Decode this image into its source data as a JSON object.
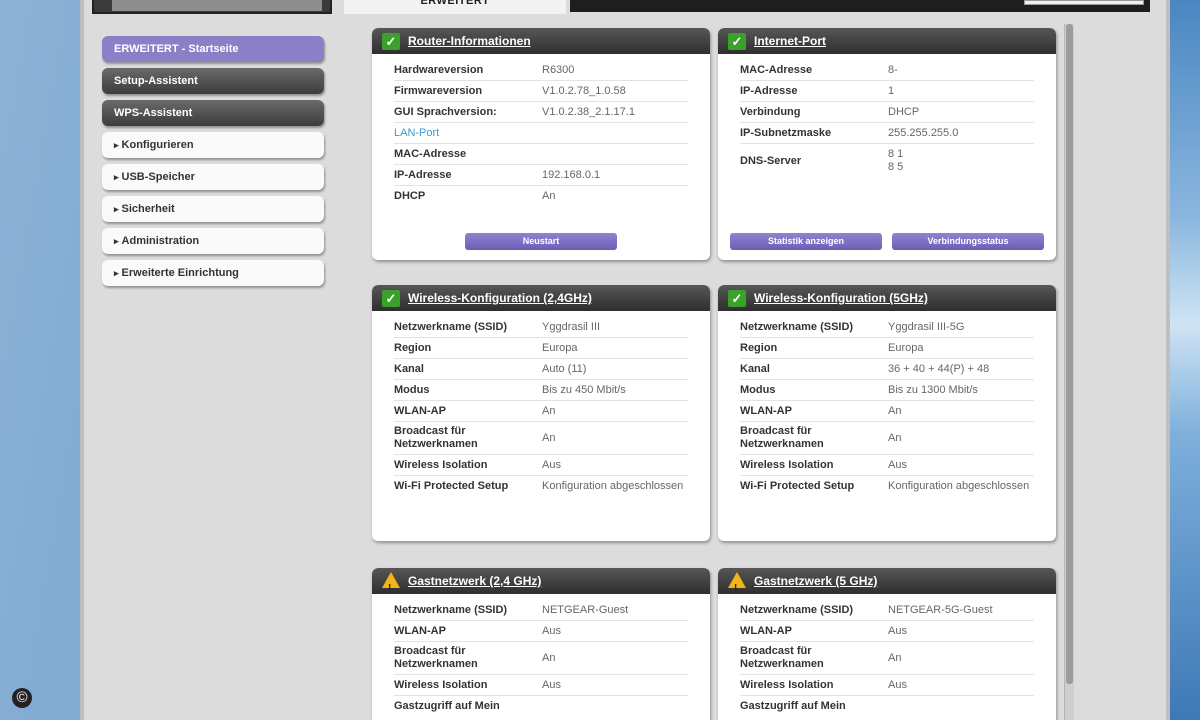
{
  "topbar": {
    "tab_erweitert": "ERWEITERT"
  },
  "sidebar": {
    "items": [
      {
        "label": "ERWEITERT - Startseite"
      },
      {
        "label": "Setup-Assistent"
      },
      {
        "label": "WPS-Assistent"
      },
      {
        "label": "Konfigurieren"
      },
      {
        "label": "USB-Speicher"
      },
      {
        "label": "Sicherheit"
      },
      {
        "label": "Administration"
      },
      {
        "label": "Erweiterte Einrichtung"
      }
    ]
  },
  "router": {
    "title": "Router-Informationen",
    "rows": [
      {
        "k": "Hardwareversion",
        "v": "R6300"
      },
      {
        "k": "Firmwareversion",
        "v": "V1.0.2.78_1.0.58"
      },
      {
        "k": "GUI Sprachversion:",
        "v": "V1.0.2.38_2.1.17.1"
      },
      {
        "k": "LAN-Port",
        "v": ""
      },
      {
        "k": "MAC-Adresse",
        "v": ""
      },
      {
        "k": "IP-Adresse",
        "v": "192.168.0.1"
      },
      {
        "k": "DHCP",
        "v": "An"
      }
    ],
    "button": "Neustart"
  },
  "internet": {
    "title": "Internet-Port",
    "rows": [
      {
        "k": "MAC-Adresse",
        "v": "8-"
      },
      {
        "k": "IP-Adresse",
        "v": "1"
      },
      {
        "k": "Verbindung",
        "v": "DHCP"
      },
      {
        "k": "IP-Subnetzmaske",
        "v": "255.255.255.0"
      },
      {
        "k": "DNS-Server",
        "v": "8 1\n8 5"
      }
    ],
    "button1": "Statistik anzeigen",
    "button2": "Verbindungsstatus"
  },
  "wireless24": {
    "title": "Wireless-Konfiguration (2,4GHz)",
    "rows": [
      {
        "k": "Netzwerkname (SSID)",
        "v": "Yggdrasil III"
      },
      {
        "k": "Region",
        "v": "Europa"
      },
      {
        "k": "Kanal",
        "v": "Auto (11)"
      },
      {
        "k": "Modus",
        "v": "Bis zu 450 Mbit/s"
      },
      {
        "k": "WLAN-AP",
        "v": "An"
      },
      {
        "k": "Broadcast für Netzwerknamen",
        "v": "An"
      },
      {
        "k": "Wireless Isolation",
        "v": "Aus"
      },
      {
        "k": "Wi-Fi Protected Setup",
        "v": "Konfiguration abgeschlossen"
      }
    ]
  },
  "wireless5": {
    "title": "Wireless-Konfiguration (5GHz)",
    "rows": [
      {
        "k": "Netzwerkname (SSID)",
        "v": "Yggdrasil III-5G"
      },
      {
        "k": "Region",
        "v": "Europa"
      },
      {
        "k": "Kanal",
        "v": "36 + 40 + 44(P) + 48"
      },
      {
        "k": "Modus",
        "v": "Bis zu 1300 Mbit/s"
      },
      {
        "k": "WLAN-AP",
        "v": "An"
      },
      {
        "k": "Broadcast für Netzwerknamen",
        "v": "An"
      },
      {
        "k": "Wireless Isolation",
        "v": "Aus"
      },
      {
        "k": "Wi-Fi Protected Setup",
        "v": "Konfiguration abgeschlossen"
      }
    ]
  },
  "guest24": {
    "title": "Gastnetzwerk (2,4 GHz)",
    "rows": [
      {
        "k": "Netzwerkname (SSID)",
        "v": "NETGEAR-Guest"
      },
      {
        "k": "WLAN-AP",
        "v": "Aus"
      },
      {
        "k": "Broadcast für Netzwerknamen",
        "v": "An"
      },
      {
        "k": "Wireless Isolation",
        "v": "Aus"
      },
      {
        "k": "Gastzugriff auf Mein",
        "v": ""
      }
    ]
  },
  "guest5": {
    "title": "Gastnetzwerk (5 GHz)",
    "rows": [
      {
        "k": "Netzwerkname (SSID)",
        "v": "NETGEAR-5G-Guest"
      },
      {
        "k": "WLAN-AP",
        "v": "Aus"
      },
      {
        "k": "Broadcast für Netzwerknamen",
        "v": "An"
      },
      {
        "k": "Wireless Isolation",
        "v": "Aus"
      },
      {
        "k": "Gastzugriff auf Mein",
        "v": ""
      }
    ]
  },
  "copyright": "©"
}
